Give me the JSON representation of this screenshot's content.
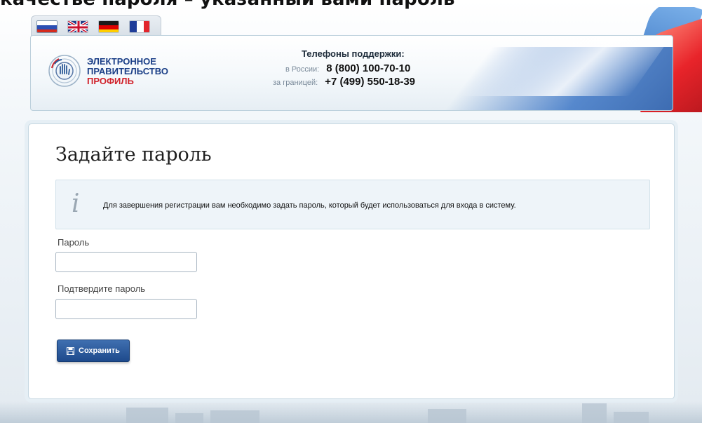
{
  "top_caption": "качестве пароля – указанный вами пароль",
  "languages": [
    {
      "name": "Русский",
      "icon": "flag-ru-icon",
      "active": true
    },
    {
      "name": "English",
      "icon": "flag-uk-icon",
      "active": false
    },
    {
      "name": "Deutsch",
      "icon": "flag-de-icon",
      "active": false
    },
    {
      "name": "Français",
      "icon": "flag-fr-icon",
      "active": false
    }
  ],
  "logo": {
    "line1": "ЭЛЕКТРОННОЕ",
    "line2": "ПРАВИТЕЛЬСТВО",
    "line3": "ПРОФИЛЬ",
    "icon": "gosuslugi-emblem-icon"
  },
  "support": {
    "title": "Телефоны поддержки:",
    "russia_label": "в России:",
    "russia_phone": "8 (800) 100-70-10",
    "abroad_label": "за границей:",
    "abroad_phone": "+7 (499) 550-18-39"
  },
  "form": {
    "title": "Задайте пароль",
    "info_icon": "info-i-icon",
    "info_text": "Для завершения регистрации вам необходимо задать пароль, который будет использоваться для входа в систему.",
    "password_label": "Пароль",
    "password_value": "",
    "confirm_label": "Подтвердите пароль",
    "confirm_value": "",
    "save_label": "Сохранить",
    "save_icon": "floppy-disk-icon"
  },
  "colors": {
    "brand_blue": "#1b3f87",
    "brand_red": "#d0212a",
    "button_blue": "#1e4a8c",
    "info_bg": "#eef4f9"
  }
}
